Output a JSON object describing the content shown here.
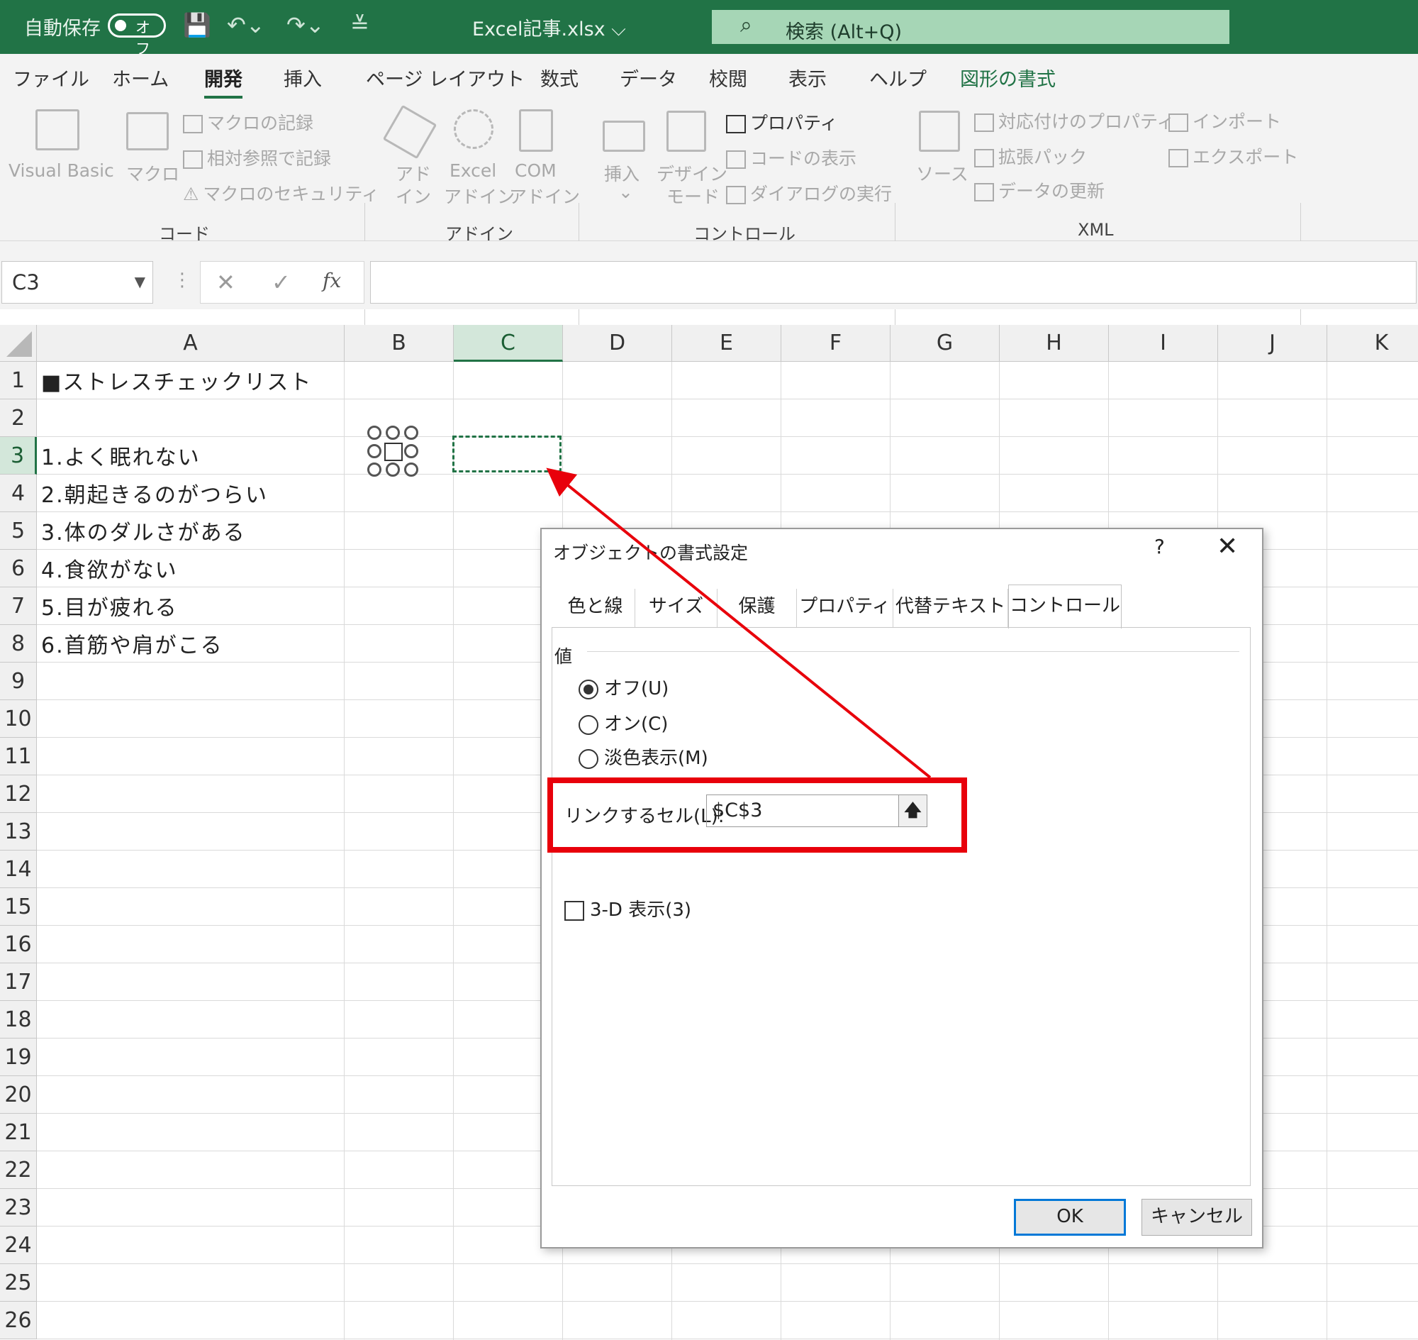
{
  "titlebar": {
    "autosave_label": "自動保存",
    "toggle_label": "オフ",
    "filename": "Excel記事.xlsx ⌵",
    "search_placeholder": "検索 (Alt+Q)",
    "colors": {
      "background": "#217346",
      "search_bg": "#a6d6b6"
    }
  },
  "ribbon_tabs": [
    "ファイル",
    "ホーム",
    "開発",
    "挿入",
    "ページ レイアウト",
    "数式",
    "データ",
    "校閲",
    "表示",
    "ヘルプ",
    "図形の書式"
  ],
  "active_tab": "開発",
  "ribbon": {
    "code": {
      "label": "コード",
      "visual_basic": "Visual Basic",
      "macro": "マクロ",
      "record_macro": "マクロの記録",
      "relative_ref": "相対参照で記録",
      "macro_security": "マクロのセキュリティ"
    },
    "addins": {
      "label": "アドイン",
      "addin_line1": "アド",
      "addin_line2": "イン",
      "excel_line1": "Excel",
      "excel_line2": "アドイン",
      "com_line1": "COM",
      "com_line2": "アドイン"
    },
    "controls": {
      "label": "コントロール",
      "insert": "挿入",
      "insert_arrow": "⌄",
      "design_line1": "デザイン",
      "design_line2": "モード",
      "properties": "プロパティ",
      "view_code": "コードの表示",
      "run_dialog": "ダイアログの実行"
    },
    "xml": {
      "label": "XML",
      "source": "ソース",
      "map_properties": "対応付けのプロパティ",
      "expansion_packs": "拡張パック",
      "refresh_data": "データの更新",
      "import": "インポート",
      "export": "エクスポート"
    }
  },
  "formula_bar": {
    "name_box": "C3",
    "dots": "⋮",
    "cancel_glyph": "✕",
    "enter_glyph": "✓",
    "fx_glyph": "fx",
    "formula": ""
  },
  "sheet": {
    "columns": [
      "A",
      "B",
      "C",
      "D",
      "E",
      "F",
      "G",
      "H",
      "I",
      "J",
      "K"
    ],
    "rows": [
      "1",
      "2",
      "3",
      "4",
      "5",
      "6",
      "7",
      "8",
      "9",
      "10",
      "11",
      "12",
      "13",
      "14",
      "15",
      "16",
      "17",
      "18",
      "19",
      "20",
      "21",
      "22",
      "23",
      "24",
      "25",
      "26"
    ],
    "selected_cell": "C3",
    "cells": {
      "A1": "■ストレスチェックリスト",
      "A3": "1.よく眠れない",
      "A4": "2.朝起きるのがつらい",
      "A5": "3.体のダルさがある",
      "A6": "4.食欲がない",
      "A7": "5.目が疲れる",
      "A8": "6.首筋や肩がこる"
    }
  },
  "dialog": {
    "title": "オブジェクトの書式設定",
    "help": "?",
    "close": "✕",
    "tabs": [
      "色と線",
      "サイズ",
      "保護",
      "プロパティ",
      "代替テキスト",
      "コントロール"
    ],
    "active_tab": "コントロール",
    "value_group": "値",
    "radio_off": "オフ(U)",
    "radio_on": "オン(C)",
    "radio_mixed": "淡色表示(M)",
    "selected_value": "オフ(U)",
    "cell_link_label": "リンクするセル(L):",
    "cell_link_value": "$C$3",
    "collapse_icon": "🡅",
    "three_d_label": "3-D 表示(3)",
    "three_d_checked": false,
    "ok": "OK",
    "cancel": "キャンセル"
  },
  "annotation": {
    "color": "#e8000b"
  }
}
